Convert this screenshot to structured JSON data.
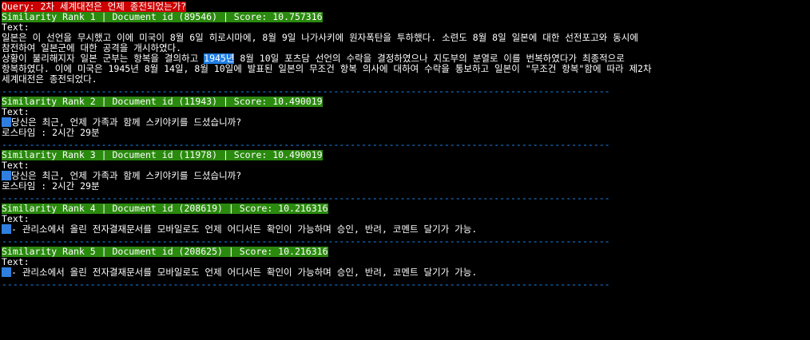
{
  "query": "Query: 2차 세계대전은 언제 종전되었는가?",
  "separator": "--------------------------------------------------------------------------------------------------------------",
  "results": [
    {
      "header": "Similarity Rank 1 | Document id (89546) | Score: 10.757316",
      "text_label": "Text:",
      "lines": [
        "일본은 이 선언을 무시했고 이에 미국이 8월 6일 히로시마에, 8월 9일 나가사키에 원자폭탄을 투하했다. 소련도 8월 8일 일본에 대한 선전포고와 동시에",
        "참전하여 일본군에 대한 공격을 개시하였다.",
        "상황이 불리해지자 일본 군부는 항복을 결의하고 "
      ],
      "highlight": "1945년",
      "after_highlight": " 8월 10일 포츠담 선언의 수락을 결정하였으나 지도부의 분열로 이를 번복하였다가 최종적으로",
      "lines_after": [
        "항복하였다. 이에 미국은 1945년 8월 14일, 8월 10일에 발표된 일본의 무조건 항복 의사에 대하여 수락을 통보하고 일본이 \"무조건 항복\"함에 따라 제2차",
        "세계대전은 종전되었다."
      ]
    },
    {
      "header": "Similarity Rank 2 | Document id (11943) | Score: 10.490019",
      "text_label": "Text:",
      "line1": "당신은 최근, 언제 가족과 함께 스키야키를 드셨습니까?",
      "line2": "로스타임 : 2시간 29분"
    },
    {
      "header": "Similarity Rank 3 | Document id (11978) | Score: 10.490019",
      "text_label": "Text:",
      "line1": "당신은 최근, 언제 가족과 함께 스키야키를 드셨습니까?",
      "line2": "로스타임 : 2시간 29분"
    },
    {
      "header": "Similarity Rank 4 | Document id (208619) | Score: 10.216316",
      "text_label": "Text:",
      "line1": "- 관리소에서 올린 전자결재문서를 모바일로도 언제 어디서든 확인이 가능하며 승인, 반려, 코멘트 달기가 가능."
    },
    {
      "header": "Similarity Rank 5 | Document id (208625) | Score: 10.216316",
      "text_label": "Text:",
      "line1": "- 관리소에서 올린 전자결재문서를 모바일로도 언제 어디서든 확인이 가능하며 승인, 반려, 코멘트 달기가 가능."
    }
  ],
  "colors": {
    "background": "#000000",
    "query_bg": "#cc0000",
    "header_bg": "#2a8a0e",
    "highlight_bg": "#1e7ee6",
    "separator": "#1e90ff"
  }
}
